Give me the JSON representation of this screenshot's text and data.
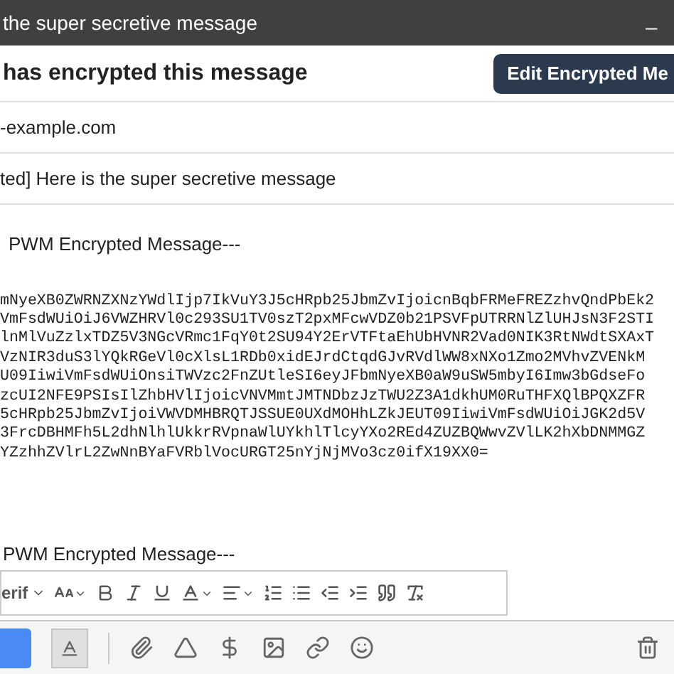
{
  "window": {
    "title": "the super secretive message",
    "minimize": "_"
  },
  "banner": {
    "text": "has encrypted this message",
    "button": "Edit Encrypted Me"
  },
  "recipients": "-example.com",
  "subject": "ted] Here is the super secretive message",
  "body": {
    "header": "PWM Encrypted Message---",
    "cipher_lines": [
      "mNyeXB0ZWRNZXNzYWdlIjp7IkVuY3J5cHRpb25JbmZvIjoicnBqbFRMeFREZzhvQndPbEk2",
      "VmFsdWUiOiJ6VWZHRVl0c293SU1TV0szT2pxMFcwVDZ0b21PSVFpUTRRNlZlUHJsN3F2STI",
      "lnMlVuZzlxTDZ5V3NGcVRmc1FqY0t2SU94Y2ErVTFtaEhUbHVNR2Vad0NIK3RtNWdtSXAxT",
      "VzNIR3duS3lYQkRGeVl0cXlsL1RDb0xidEJrdCtqdGJvRVdlWW8xNXo1Zmo2MVhvZVENkM",
      "U09IiwiVmFsdWUiOnsiTWVzc2FnZUtleSI6eyJFbmNyeXB0aW9uSW5mbyI6Imw3bGdseFo",
      "zcUI2NFE9PSIsIlZhbHVlIjoicVNVMmtJMTNDbzJzTWU2Z3A1dkhUM0RuTHFXQlBPQXZFR",
      "5cHRpb25JbmZvIjoiVWVDMHBRQTJSSUE0UXdMOHhLZkJEUT09IiwiVmFsdWUiOiJGK2d5V",
      "3FrcDBHMFh5L2dhNlhlUkkrRVpnaWlUYkhlTlcyYXo2REd4ZUZBQWwvZVlLK2hXbDNMMGZ",
      "YZzhhZVlrL2ZwNnBYaFVRblVocURGT25nYjNjMVo3cz0ifX19XX0="
    ],
    "footer": "PWM Encrypted Message---"
  },
  "format_toolbar": {
    "font": "erif",
    "tools": [
      {
        "kind": "size"
      },
      {
        "kind": "bold"
      },
      {
        "kind": "italic"
      },
      {
        "kind": "underline"
      },
      {
        "kind": "color"
      },
      {
        "kind": "align"
      },
      {
        "kind": "numbered"
      },
      {
        "kind": "bulleted"
      },
      {
        "kind": "outdent"
      },
      {
        "kind": "indent"
      },
      {
        "kind": "quote"
      },
      {
        "kind": "clear"
      }
    ]
  },
  "bottom_toolbar": {
    "formatting_selected": true,
    "tools": [
      {
        "kind": "attach"
      },
      {
        "kind": "drive"
      },
      {
        "kind": "money"
      },
      {
        "kind": "photo"
      },
      {
        "kind": "link"
      },
      {
        "kind": "emoji"
      }
    ]
  }
}
